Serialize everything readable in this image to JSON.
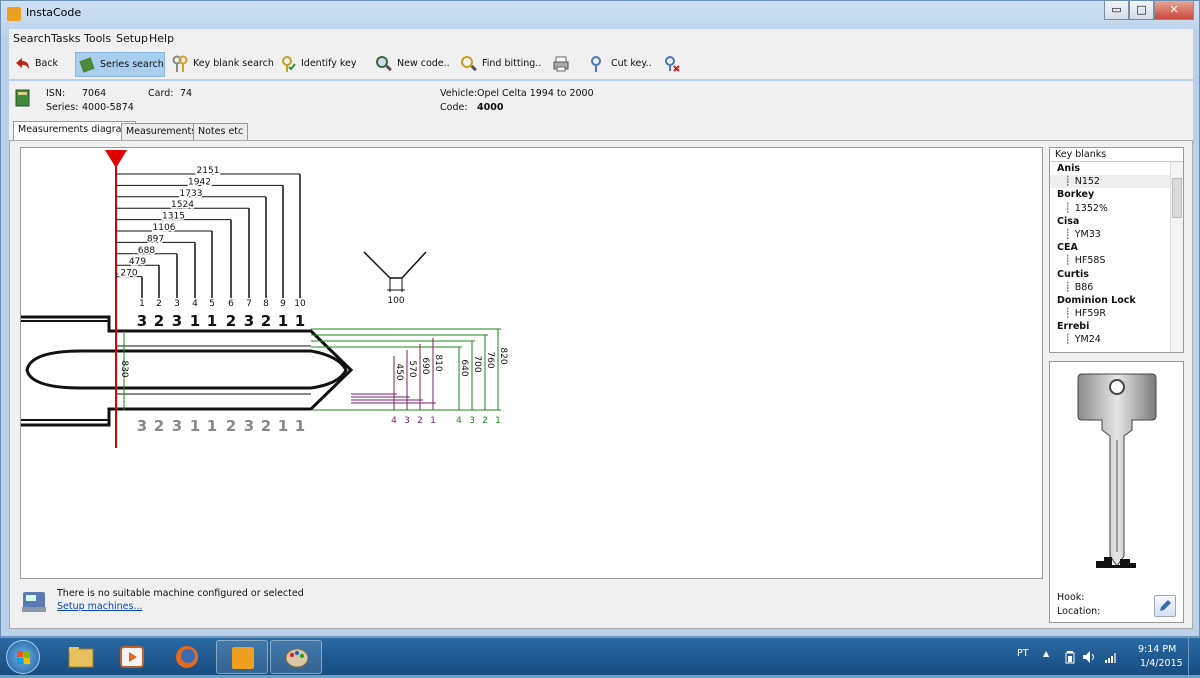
{
  "window": {
    "title": "InstaCode",
    "minimize": "▭",
    "maximize": "□",
    "close": "✕"
  },
  "menu": [
    "Search",
    "Tasks",
    "Tools",
    "Setup",
    "Help"
  ],
  "toolbar": {
    "back": "Back",
    "series_search": "Series search",
    "key_blank_search": "Key blank search",
    "identify_key": "Identify key",
    "new_code": "New code..",
    "find_bitting": "Find bitting..",
    "cut_key": "Cut key.."
  },
  "info": {
    "isn_label": "ISN:",
    "isn": "7064",
    "card_label": "Card:",
    "card": "74",
    "series_label": "Series:",
    "series": "4000-5874",
    "vehicle_label": "Vehicle:",
    "vehicle": "Opel Celta 1994 to 2000",
    "code_label": "Code:",
    "code": "4000"
  },
  "tabs": [
    "Measurements diagram",
    "Measurements",
    "Notes etc"
  ],
  "diagram": {
    "spacing": [
      "2151",
      "1942",
      "1733",
      "1524",
      "1315",
      "1106",
      "897",
      "688",
      "479",
      "270"
    ],
    "positions": [
      "1",
      "2",
      "3",
      "4",
      "5",
      "6",
      "7",
      "8",
      "9",
      "10"
    ],
    "cuts_top": [
      "3",
      "2",
      "3",
      "1",
      "1",
      "2",
      "3",
      "2",
      "1",
      "1"
    ],
    "cuts_bottom": [
      "3",
      "2",
      "3",
      "1",
      "1",
      "2",
      "3",
      "2",
      "1",
      "1"
    ],
    "angle_width": "100",
    "blade_width": "830",
    "depths_purple": [
      "450",
      "570",
      "690",
      "810"
    ],
    "depths_purple_idx": [
      "4",
      "3",
      "2",
      "1"
    ],
    "depths_green": [
      "640",
      "700",
      "760",
      "820"
    ],
    "depths_green_idx": [
      "4",
      "3",
      "2",
      "1"
    ],
    "colors": {
      "stop": "#e00000",
      "purple": "#7a1f6e",
      "green": "#1a8a1a"
    }
  },
  "key_blanks": {
    "header": "Key blanks",
    "items": [
      {
        "maker": "Anis",
        "code": "N152"
      },
      {
        "maker": "Borkey",
        "code": "1352%"
      },
      {
        "maker": "Curtis",
        "code": "B86"
      },
      {
        "maker": "CEA",
        "code": "HF58S"
      },
      {
        "maker": "Dominion Lock",
        "code": "HF59R"
      },
      {
        "maker": "Errebi",
        "code": "YM24"
      }
    ]
  },
  "key_blanks_order": [
    {
      "maker": "Anis",
      "code": "N152"
    },
    {
      "maker": "Borkey",
      "code": "1352%"
    },
    {
      "maker": "Cisa",
      "code": "YM33"
    },
    {
      "maker": "CEA",
      "code": "HF58S"
    },
    {
      "maker": "Curtis",
      "code": "B86"
    },
    {
      "maker": "Dominion Lock",
      "code": "HF59R"
    },
    {
      "maker": "Errebi",
      "code": "YM24"
    }
  ],
  "key_info": {
    "hook_label": "Hook:",
    "location_label": "Location:"
  },
  "machine": {
    "status": "There is no suitable machine configured or selected",
    "setup_link": "Setup machines..."
  },
  "tray": {
    "lang": "PT",
    "time": "9:14 PM",
    "date": "1/4/2015"
  }
}
